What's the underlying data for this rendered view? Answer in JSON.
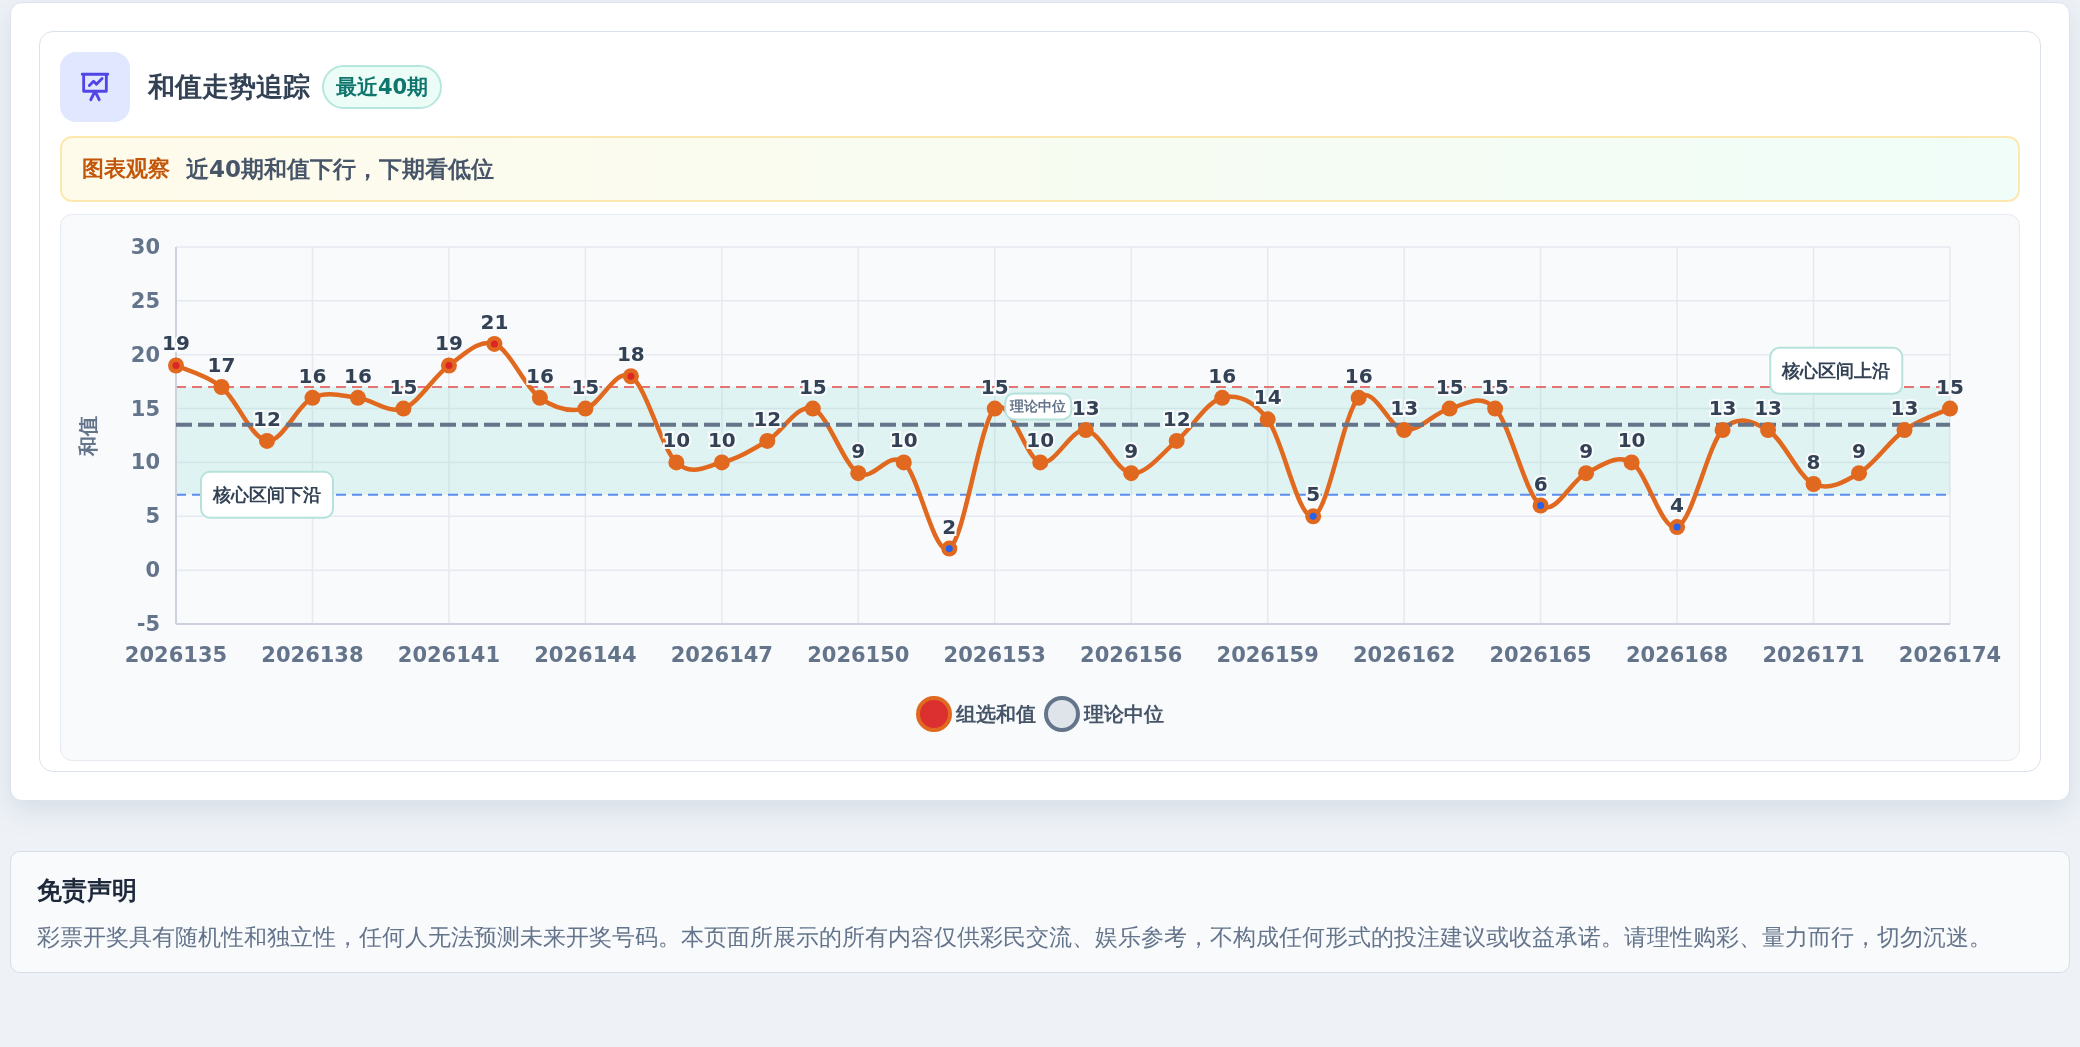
{
  "trend_card": {
    "title": "和值走势追踪",
    "badge": "最近40期",
    "observation": {
      "label": "图表观察",
      "text": "近40期和值下行，下期看低位"
    },
    "chart_data": {
      "type": "line",
      "ylabel": "和值",
      "x": [
        2026135,
        2026136,
        2026137,
        2026138,
        2026139,
        2026140,
        2026141,
        2026142,
        2026143,
        2026144,
        2026145,
        2026146,
        2026147,
        2026148,
        2026149,
        2026150,
        2026151,
        2026152,
        2026153,
        2026154,
        2026155,
        2026156,
        2026157,
        2026158,
        2026159,
        2026160,
        2026161,
        2026162,
        2026163,
        2026164,
        2026165,
        2026166,
        2026167,
        2026168,
        2026169,
        2026170,
        2026171,
        2026172,
        2026173,
        2026174
      ],
      "series": [
        {
          "name": "组选和值",
          "color": "#e0691f",
          "marker": "circle",
          "values": [
            19,
            17,
            12,
            16,
            16,
            15,
            19,
            21,
            16,
            15,
            18,
            10,
            10,
            12,
            15,
            9,
            10,
            2,
            15,
            10,
            13,
            9,
            12,
            16,
            14,
            5,
            16,
            13,
            15,
            15,
            6,
            9,
            10,
            4,
            13,
            13,
            8,
            9,
            13,
            15
          ],
          "value_labels": [
            "19",
            "17",
            "12",
            "16",
            "16",
            "15",
            "19",
            "21",
            "16",
            "15",
            "18",
            "10",
            "10",
            "12",
            "15",
            "9",
            "10",
            "2",
            "15",
            "10",
            "13",
            "9",
            "12",
            "16",
            "14",
            "5",
            "16",
            "13",
            "15",
            "15",
            "6",
            "9",
            "10",
            "4",
            "13",
            "13",
            "8",
            "9",
            "13",
            "15"
          ]
        },
        {
          "name": "理论中位",
          "color": "#64748b",
          "line_style": "dashed",
          "values": [
            13.5,
            13.5,
            13.5,
            13.5,
            13.5,
            13.5,
            13.5,
            13.5,
            13.5,
            13.5,
            13.5,
            13.5,
            13.5,
            13.5,
            13.5,
            13.5,
            13.5,
            13.5,
            13.5,
            13.5,
            13.5,
            13.5,
            13.5,
            13.5,
            13.5,
            13.5,
            13.5,
            13.5,
            13.5,
            13.5,
            13.5,
            13.5,
            13.5,
            13.5,
            13.5,
            13.5,
            13.5,
            13.5,
            13.5,
            13.5
          ]
        }
      ],
      "xlim": [
        2026135,
        2026174
      ],
      "ylim": [
        -5,
        30
      ],
      "yticks": [
        -5,
        0,
        5,
        10,
        15,
        20,
        25,
        30
      ],
      "xticks": [
        2026135,
        2026138,
        2026141,
        2026144,
        2026147,
        2026150,
        2026153,
        2026156,
        2026159,
        2026162,
        2026165,
        2026168,
        2026171,
        2026174
      ],
      "grid": true,
      "bands": [
        {
          "axis": "y",
          "from": 7,
          "to": 17,
          "color": "#14b8a6"
        }
      ],
      "ref_lines": [
        {
          "axis": "y",
          "value": 17,
          "label": "核心区间上沿",
          "color": "#e57373",
          "line_style": "dashed"
        },
        {
          "axis": "y",
          "value": 7,
          "label": "核心区间下沿",
          "color": "#5b8def",
          "line_style": "dashed"
        }
      ],
      "annotations": [
        "理论中位"
      ]
    }
  },
  "disclaimer": {
    "title": "免责声明",
    "text": "彩票开奖具有随机性和独立性，任何人无法预测未来开奖号码。本页面所展示的所有内容仅供彩民交流、娱乐参考，不构成任何形式的投注建议或收益承诺。请理性购彩、量力而行，切勿沉迷。"
  }
}
